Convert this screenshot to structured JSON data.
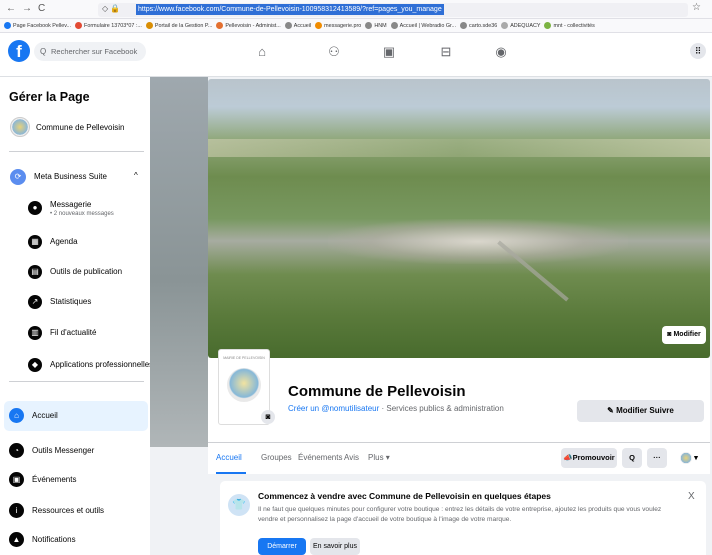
{
  "browser": {
    "back": "←",
    "forward": "→",
    "reload": "C",
    "url": "https://www.facebook.com/Commune-de-Pellevoisin-100958312413589/?ref=pages_you_manage",
    "star": "☆"
  },
  "bookmarks": [
    {
      "label": "Page Facebook Pellev...",
      "color": "#1877f2"
    },
    {
      "label": "Formulaire 13703*07 :...",
      "color": "#e24a33"
    },
    {
      "label": "Portail de la Gestion P...",
      "color": "#d98e04"
    },
    {
      "label": "Pellevoisin - Administ...",
      "color": "#e36f2f"
    },
    {
      "label": "Accueil",
      "color": "#888888"
    },
    {
      "label": "messagerie.pro",
      "color": "#f08c00"
    },
    {
      "label": "HNM",
      "color": "#888888"
    },
    {
      "label": "Accueil | Webradio Gr...",
      "color": "#888888"
    },
    {
      "label": "carto.sde36",
      "color": "#888888"
    },
    {
      "label": "ADEQUACY",
      "color": "#aaaaaa"
    },
    {
      "label": "mnt - collectivités",
      "color": "#7cb342"
    }
  ],
  "fb": {
    "logo": "f",
    "search_placeholder": "Rechercher sur Facebook"
  },
  "sidebar": {
    "title": "Gérer la Page",
    "page_name": "Commune de Pellevoisin",
    "meta_suite": "Meta Business Suite",
    "items": [
      {
        "label": "Messagerie",
        "sub": "• 2 nouveaux messages",
        "icon": "chat-bubble-icon"
      },
      {
        "label": "Agenda",
        "icon": "calendar-icon"
      },
      {
        "label": "Outils de publication",
        "icon": "publishing-tools-icon"
      },
      {
        "label": "Statistiques",
        "icon": "stats-icon"
      },
      {
        "label": "Fil d'actualité",
        "icon": "news-feed-icon"
      },
      {
        "label": "Applications professionnelles",
        "icon": "apps-icon"
      }
    ],
    "nav": [
      {
        "label": "Accueil",
        "icon": "home-icon"
      },
      {
        "label": "Outils Messenger",
        "icon": "messenger-icon"
      },
      {
        "label": "Événements",
        "icon": "events-icon"
      },
      {
        "label": "Ressources et outils",
        "icon": "info-icon"
      },
      {
        "label": "Notifications",
        "icon": "bell-icon"
      }
    ]
  },
  "page": {
    "cover_edit": "Modifier",
    "logo_text": "MAIRIE DE PELLEVOISIN",
    "name": "Commune de Pellevoisin",
    "username_link": "Créer un @nomutilisateur",
    "category": " · Services publics & administration",
    "edit_follow": "Modifier Suivre"
  },
  "tabs": [
    "Accueil",
    "Groupes",
    "Événements",
    "Avis",
    "Plus ▾"
  ],
  "actions": {
    "promote": "Promouvoir",
    "search": "Q",
    "more": "···"
  },
  "promo": {
    "title": "Commencez à vendre avec Commune de Pellevoisin en quelques étapes",
    "text": "Il ne faut que quelques minutes pour configurer votre boutique : entrez les détails de votre entreprise, ajoutez les produits que vous voulez vendre et personnalisez la page d'accueil de votre boutique à l'image de votre marque.",
    "start": "Démarrer",
    "learn": "En savoir plus",
    "close": "X"
  },
  "colors": {
    "brand": "#1877f2",
    "active_bg": "#e7f3ff"
  }
}
